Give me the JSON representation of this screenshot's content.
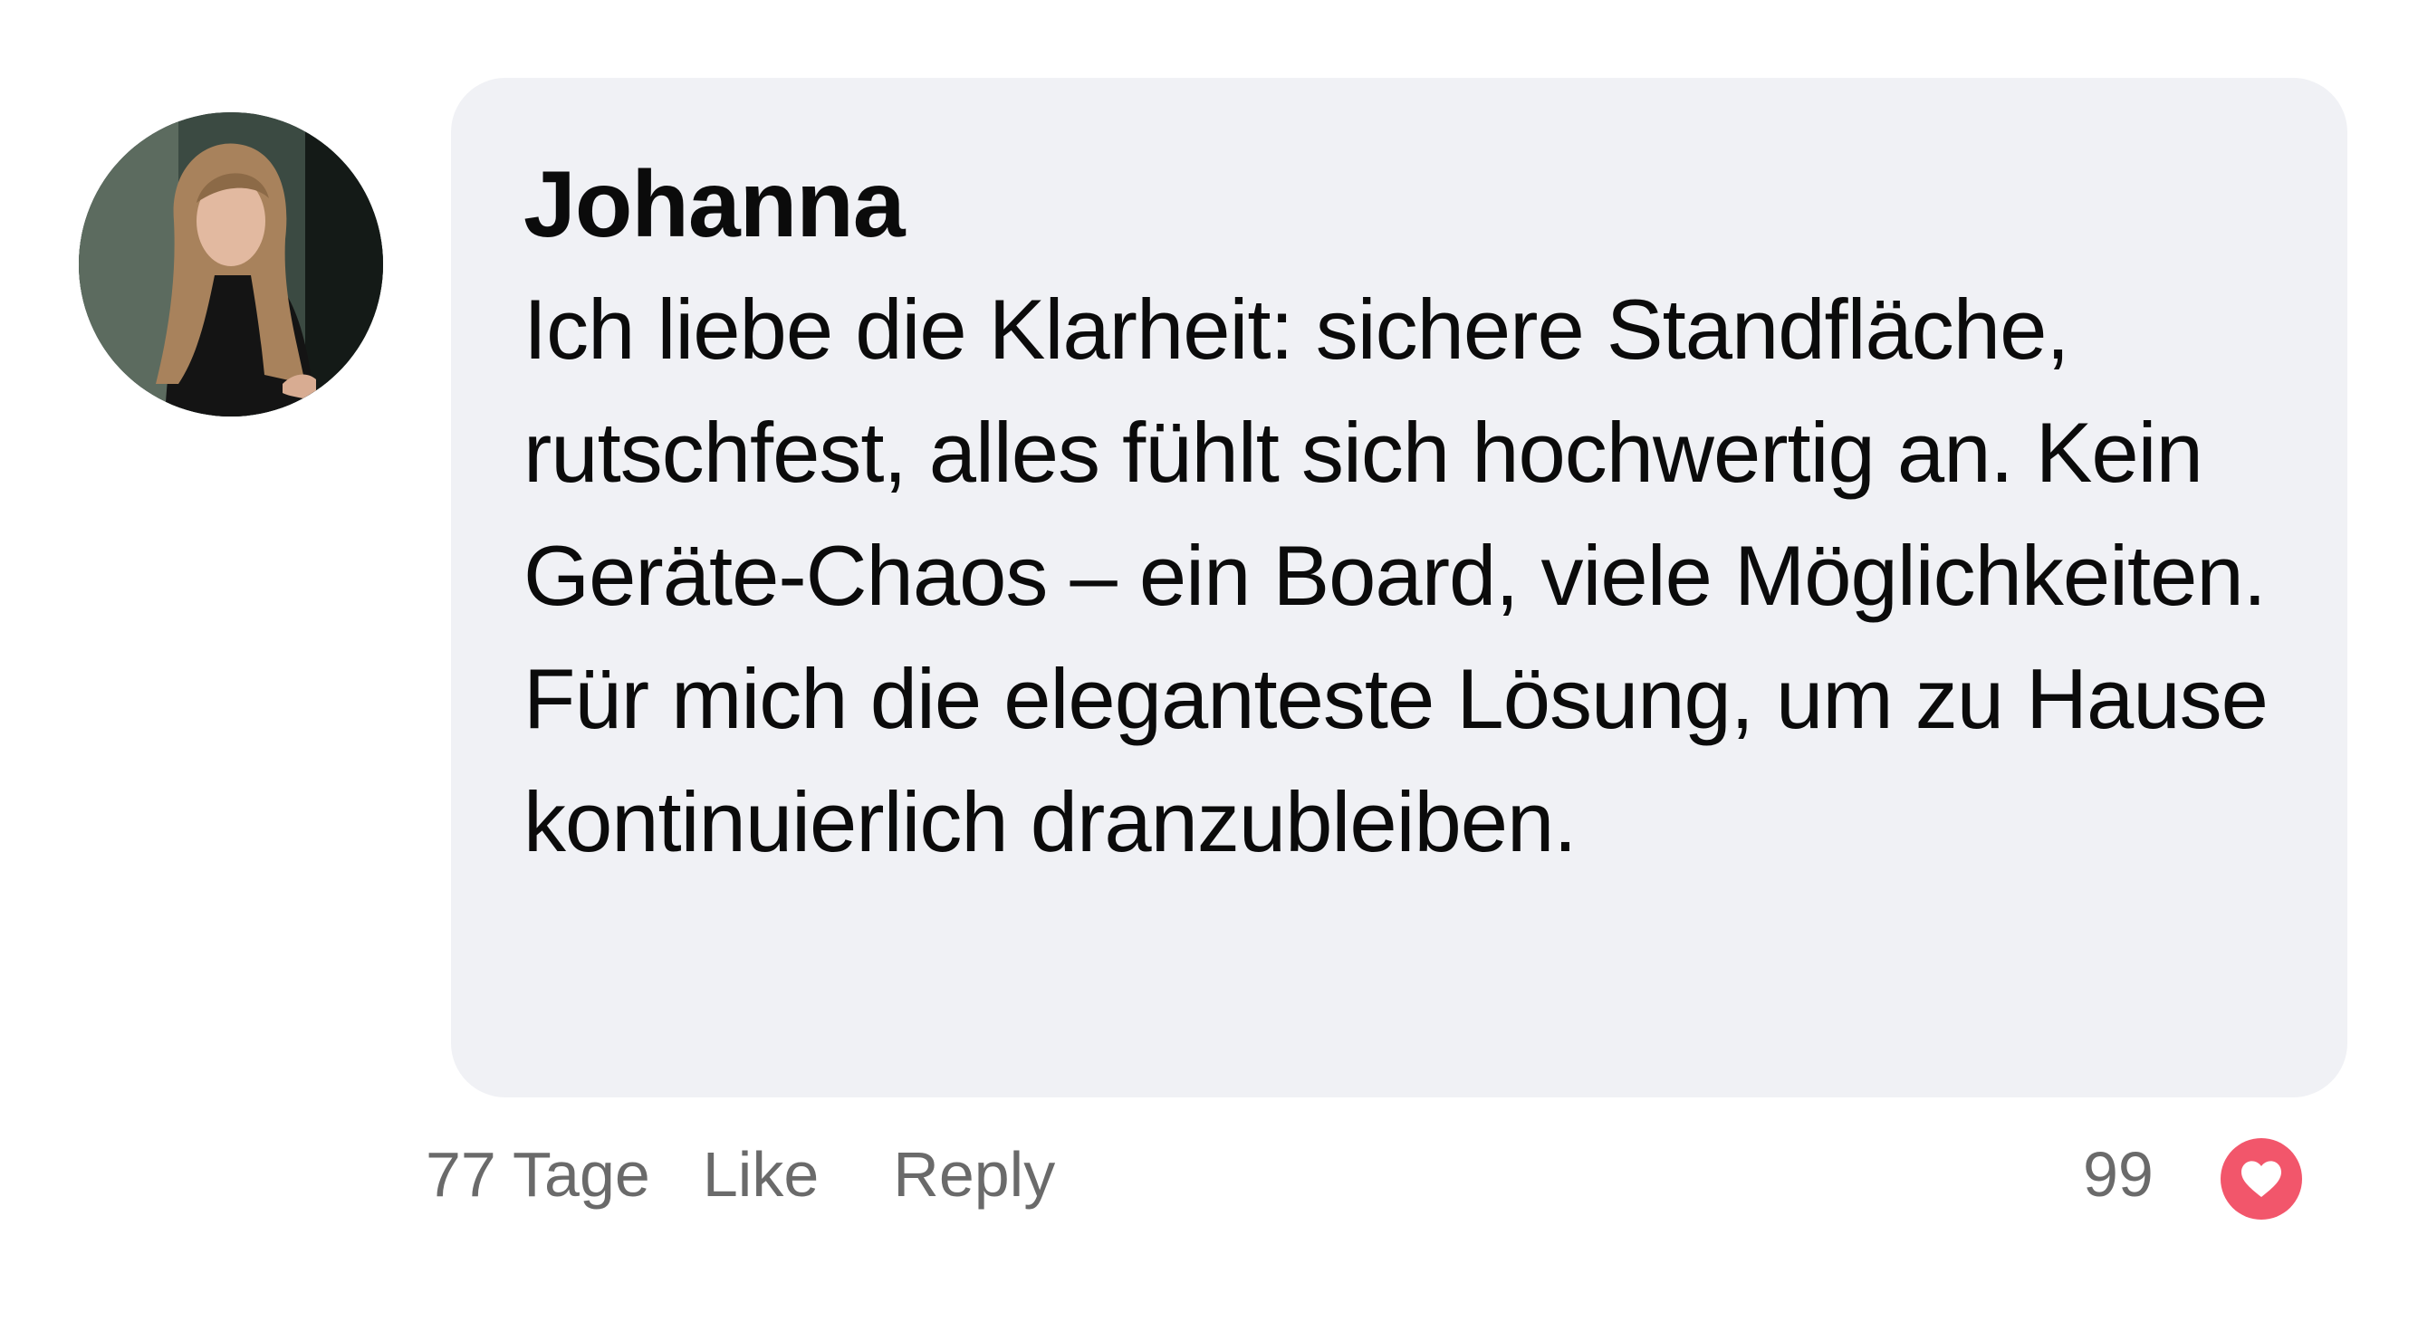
{
  "comment": {
    "author": "Johanna",
    "text": "Ich liebe die Klarheit: sichere Standfläche, rutschfest, alles fühlt sich hochwertig an. Kein Geräte-Chaos – ein Board, viele Möglichkeiten. Für mich die eleganteste Lösung, um zu Hause kontinuierlich dranzubleiben.",
    "avatar_icon": "user-photo"
  },
  "actions": {
    "time_label": "77 Tage",
    "like_label": "Like",
    "reply_label": "Reply",
    "like_count": "99",
    "heart_icon": "heart-icon",
    "heart_color": "#f2566b"
  }
}
